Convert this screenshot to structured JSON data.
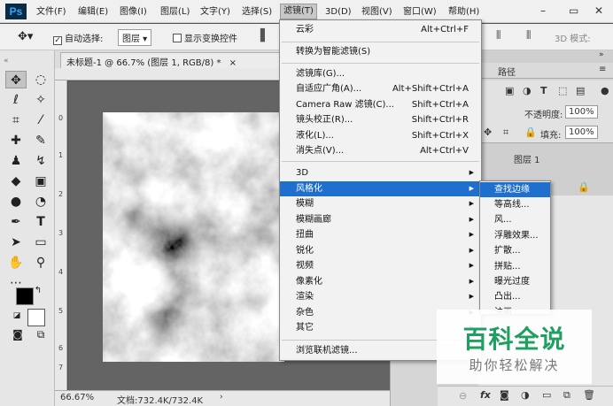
{
  "menubar": {
    "logo": "Ps",
    "items": [
      "文件(F)",
      "编辑(E)",
      "图像(I)",
      "图层(L)",
      "文字(Y)",
      "选择(S)",
      "滤镜(T)",
      "3D(D)",
      "视图(V)",
      "窗口(W)",
      "帮助(H)"
    ],
    "active_index": 6
  },
  "options": {
    "auto_select_label": "自动选择:",
    "auto_select_value": "图层",
    "show_transform_label": "显示变换控件",
    "mode_3d_label": "3D 模式:"
  },
  "document": {
    "tab_title": "未标题-1 @ 66.7% (图层 1, RGB/8) *",
    "tab_close": "×",
    "zoom": "66.67%",
    "doc_info": "文档:732.4K/732.4K",
    "ruler_left": [
      "0",
      "1",
      "2",
      "3",
      "4",
      "5",
      "6",
      "7"
    ],
    "ruler_top": [
      "2"
    ]
  },
  "panels": {
    "paths_tab": "路径",
    "opacity_label": "不透明度:",
    "opacity_value": "100%",
    "fill_label": "填充:",
    "fill_value": "100%",
    "layer_name": "图层 1"
  },
  "filter_menu": {
    "items": [
      {
        "label": "云彩",
        "shortcut": "Alt+Ctrl+F"
      },
      {
        "label": "转换为智能滤镜(S)",
        "shortcut": ""
      },
      {
        "label": "滤镜库(G)...",
        "shortcut": ""
      },
      {
        "label": "自适应广角(A)...",
        "shortcut": "Alt+Shift+Ctrl+A"
      },
      {
        "label": "Camera Raw 滤镜(C)...",
        "shortcut": "Shift+Ctrl+A"
      },
      {
        "label": "镜头校正(R)...",
        "shortcut": "Shift+Ctrl+R"
      },
      {
        "label": "液化(L)...",
        "shortcut": "Shift+Ctrl+X"
      },
      {
        "label": "消失点(V)...",
        "shortcut": "Alt+Ctrl+V"
      },
      {
        "label": "3D",
        "shortcut": ""
      },
      {
        "label": "风格化",
        "shortcut": ""
      },
      {
        "label": "模糊",
        "shortcut": ""
      },
      {
        "label": "模糊画廊",
        "shortcut": ""
      },
      {
        "label": "扭曲",
        "shortcut": ""
      },
      {
        "label": "锐化",
        "shortcut": ""
      },
      {
        "label": "视频",
        "shortcut": ""
      },
      {
        "label": "像素化",
        "shortcut": ""
      },
      {
        "label": "渲染",
        "shortcut": ""
      },
      {
        "label": "杂色",
        "shortcut": ""
      },
      {
        "label": "其它",
        "shortcut": ""
      },
      {
        "label": "浏览联机滤镜...",
        "shortcut": ""
      }
    ],
    "highlighted_index": 9
  },
  "stylize_menu": {
    "items": [
      "查找边缘",
      "等高线...",
      "风...",
      "浮雕效果...",
      "扩散...",
      "拼贴...",
      "曝光过度",
      "凸出...",
      "油画..."
    ],
    "highlighted_index": 0
  },
  "watermark": {
    "main": "百科全说",
    "sub": "助你轻松解决"
  }
}
